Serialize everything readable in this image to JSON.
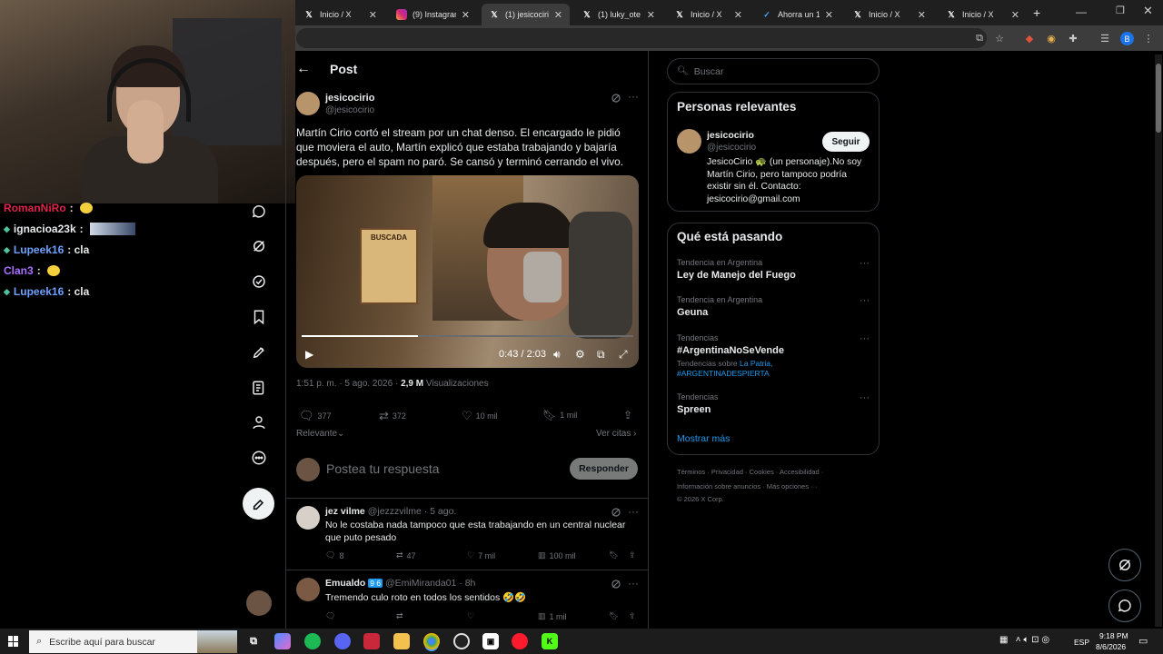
{
  "browser": {
    "tabs": [
      {
        "label": "Inicio / X",
        "icon": "x-icon"
      },
      {
        "label": "(9) Instagram",
        "icon": "instagram-icon"
      },
      {
        "label": "(1) jesicocirio",
        "icon": "x-icon"
      },
      {
        "label": "(1) luky_ote en",
        "icon": "x-icon"
      },
      {
        "label": "Inicio / X",
        "icon": "x-icon"
      },
      {
        "label": "Ahorra un 10",
        "icon": "bird-icon"
      },
      {
        "label": "Inicio / X",
        "icon": "x-icon"
      },
      {
        "label": "Inicio / X",
        "icon": "x-icon"
      }
    ],
    "new_tab": "+",
    "profile_initial": "B"
  },
  "stream_chat": [
    {
      "user": "RomanNiRo",
      "color": "#e0224a",
      "msg": ":",
      "emote": true
    },
    {
      "user": "ignacioa23k",
      "color": "#e7e9ea",
      "msg": ":",
      "badge": true,
      "image": true
    },
    {
      "user": "Lupeek16",
      "color": "#6ea0ff",
      "msg": ": cla",
      "badge": true
    },
    {
      "user": "Clan3",
      "color": "#a970ff",
      "msg": ":",
      "emote": true
    },
    {
      "user": "Lupeek16",
      "color": "#6ea0ff",
      "msg": ": cla",
      "badge": true
    }
  ],
  "post": {
    "header": "Post",
    "author_name": "jesicocirio",
    "author_handle": "@jesicocirio",
    "text": "Martín Cirio cortó el stream por un chat denso. El encargado le pidió que moviera el auto, Martín explicó que estaba trabajando y bajaría después, pero el spam no paró. Se cansó y terminó cerrando el vivo.",
    "video": {
      "time": "0:43 / 2:03",
      "progress": 0.35,
      "poster_text": "BUSCADA"
    },
    "timestamp": "1:51 p. m. · 5 ago. 2026 ·",
    "views": "2,9 M",
    "views_label": "Visualizaciones",
    "replies": "377",
    "reposts": "372",
    "likes": "10 mil",
    "bookmarks": "1 mil",
    "sort_label": "Relevante",
    "quotes_label": "Ver citas",
    "reply_placeholder": "Postea tu respuesta",
    "reply_button": "Responder"
  },
  "replies": [
    {
      "name": "jez vilme",
      "handle": "@jezzzvilme",
      "time": "· 5 ago.",
      "text": "No le costaba nada tampoco que esta trabajando en un central nuclear que puto pesado",
      "replies": "8",
      "reposts": "47",
      "likes": "7 mil",
      "views": "100 mil"
    },
    {
      "name": "Emualdo",
      "badges": "9 6",
      "handle": "@EmiMiranda01",
      "time": "· 8h",
      "text": "Tremendo culo roto en todos los sentidos 🤣🤣",
      "replies": "",
      "reposts": "",
      "likes": "",
      "views": "1 mil"
    }
  ],
  "sidebar": {
    "search_placeholder": "Buscar",
    "relevant_title": "Personas relevantes",
    "relevant_name": "jesicocirio",
    "relevant_handle": "@jesicocirio",
    "follow_label": "Seguir",
    "relevant_bio": "JesicoCirio 🐢 (un personaje).No soy Martín Cirio, pero tampoco podría existir sin él. Contacto: jesicocirio@gmail.com",
    "trends_title": "Qué está pasando",
    "trends": [
      {
        "meta": "Tendencia en Argentina",
        "name": "Ley de Manejo del Fuego",
        "extra": ""
      },
      {
        "meta": "Tendencia en Argentina",
        "name": "Geuna",
        "extra": ""
      },
      {
        "meta": "Tendencias",
        "name": "#ArgentinaNoSeVende",
        "extra_prefix": "Tendencias sobre",
        "extra": "La Patria, #ARGENTINADESPIERTA"
      },
      {
        "meta": "Tendencias",
        "name": "Spreen",
        "extra": ""
      }
    ],
    "show_more": "Mostrar más",
    "footer_line1": "Términos · Privacidad · Cookies · Accesibilidad ·",
    "footer_line2": "Información sobre anuncios · Más opciones ···",
    "footer_line3": "© 2026 X Corp."
  },
  "taskbar": {
    "search_placeholder": "Escribe aquí para buscar",
    "lang": "ESP",
    "time": "9:18 PM",
    "date": "8/6/2026"
  },
  "colors": {
    "accent": "#1d9bf0",
    "bg": "#000000",
    "border": "#2f3336",
    "muted": "#71767b"
  }
}
